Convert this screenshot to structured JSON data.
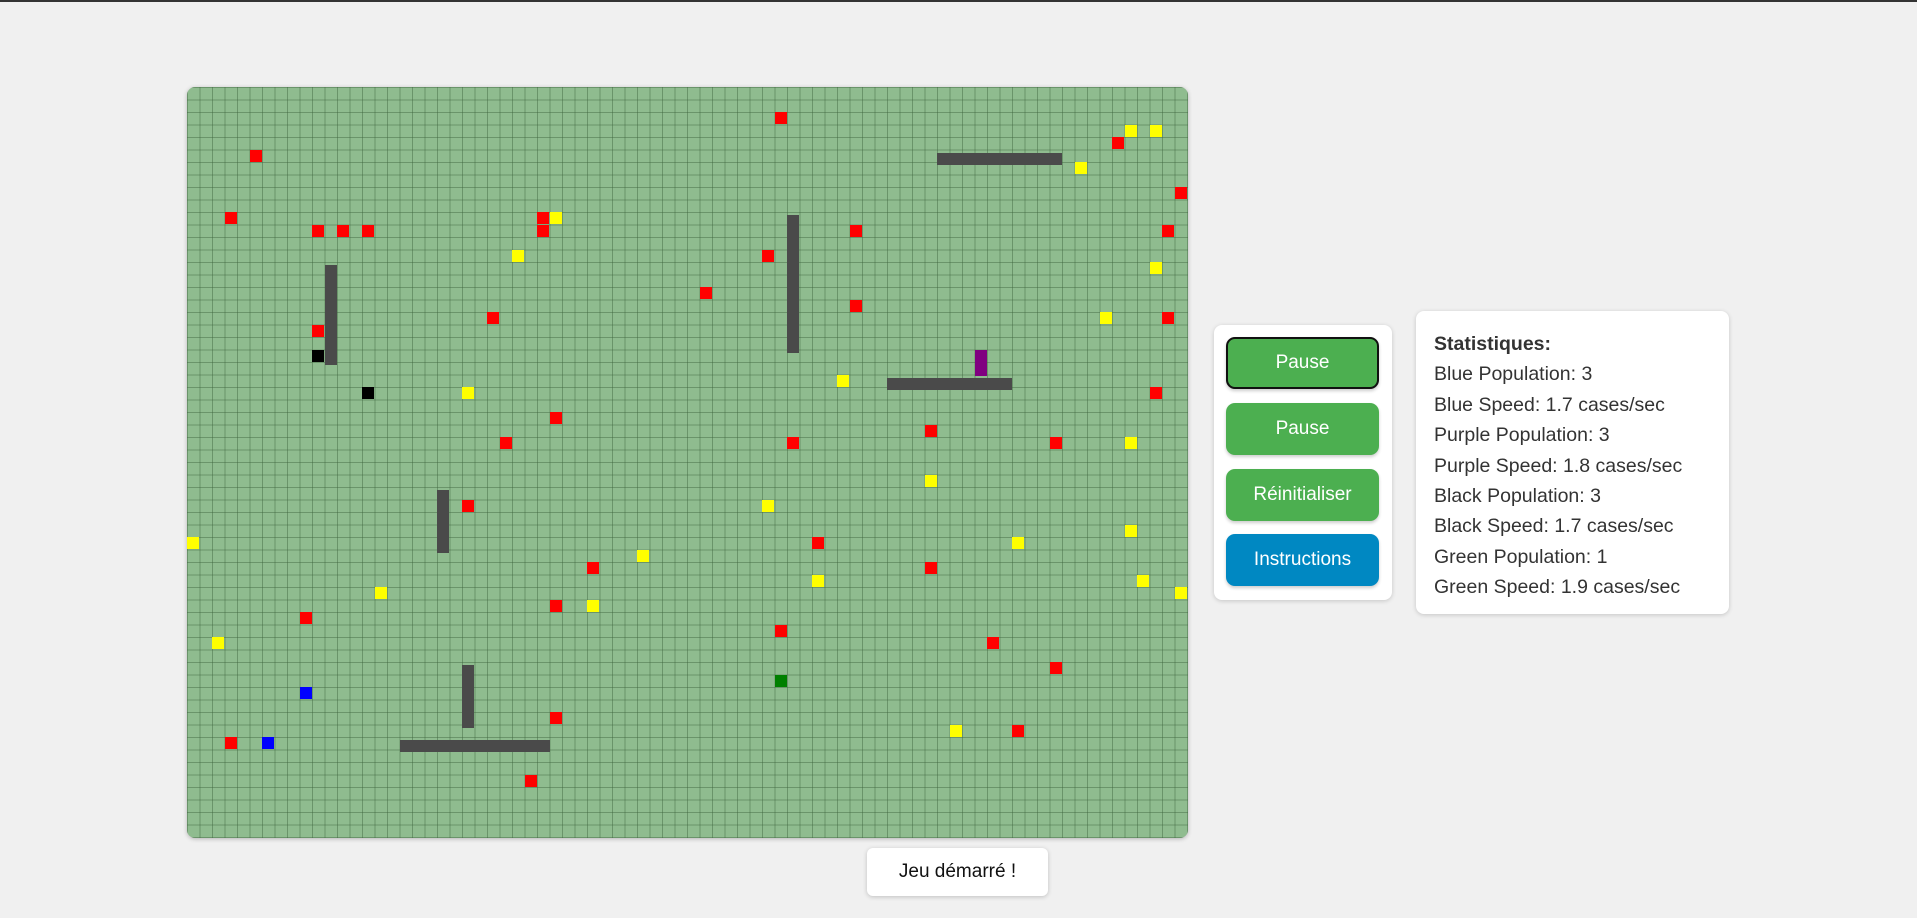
{
  "colors": {
    "board_bg": "#8fbc8f",
    "food": "#ff0000",
    "bonus": "#ffff00",
    "blue_creature": "#0000ff",
    "purple_creature": "#800080",
    "black_creature": "#000000",
    "green_creature": "#008000",
    "wall": "#4a4a4a",
    "button_green": "#4caf50",
    "button_blue": "#0088c2"
  },
  "controls": {
    "pause_label_1": "Pause",
    "pause_label_2": "Pause",
    "reset_label": "Réinitialiser",
    "instructions_label": "Instructions"
  },
  "stats": {
    "title": "Statistiques:",
    "rows": [
      "Blue Population: 3",
      "Blue Speed: 1.7 cases/sec",
      "Purple Population: 3",
      "Purple Speed: 1.8 cases/sec",
      "Black Population: 3",
      "Black Speed: 1.7 cases/sec",
      "Green Population: 1",
      "Green Speed: 1.9 cases/sec"
    ]
  },
  "status": {
    "message": "Jeu démarré !"
  }
}
